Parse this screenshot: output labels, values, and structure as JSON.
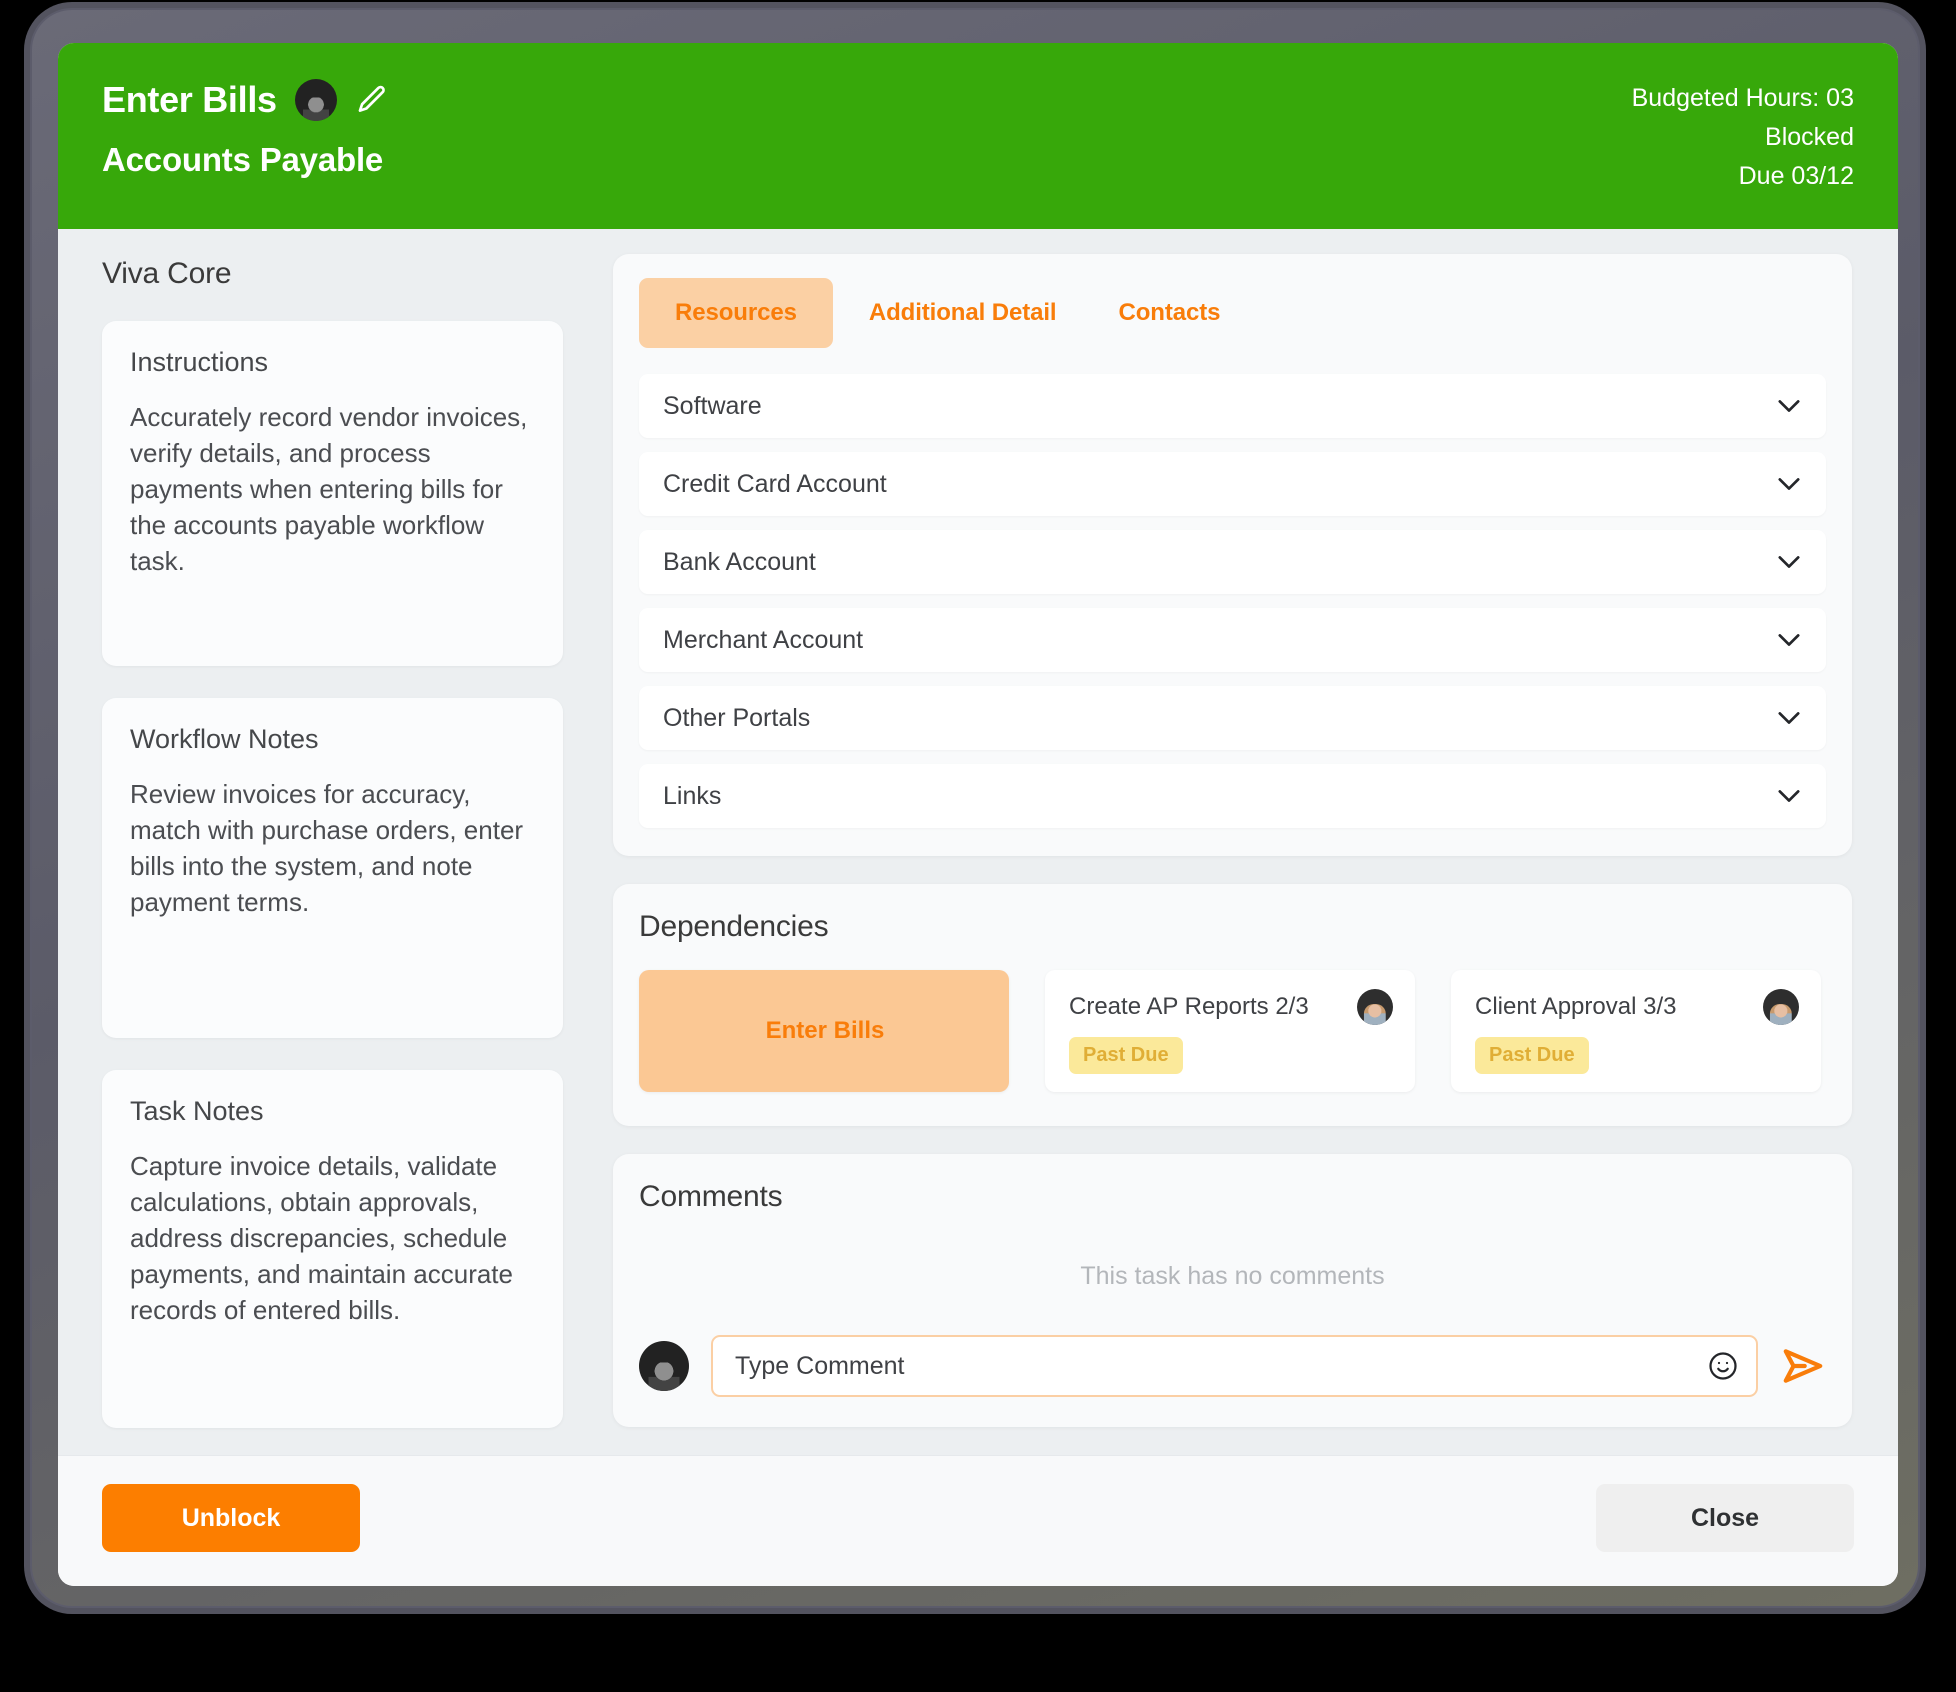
{
  "header": {
    "title": "Enter Bills",
    "subtitle": "Accounts Payable",
    "avatar_name": "assignee-avatar",
    "edit_icon": "pencil-icon",
    "budgeted_hours": "Budgeted Hours: 03",
    "status": "Blocked",
    "due": "Due 03/12",
    "background_color": "#37a80a"
  },
  "sidebar": {
    "title": "Viva Core",
    "cards": [
      {
        "title": "Instructions",
        "body": "Accurately record vendor invoices, verify details, and process payments when entering bills for the accounts payable workflow task."
      },
      {
        "title": "Workflow Notes",
        "body": "Review invoices for accuracy, match with purchase orders, enter bills into the system, and note payment terms."
      },
      {
        "title": "Task Notes",
        "body": "Capture invoice details, validate calculations, obtain approvals, address discrepancies, schedule payments, and maintain accurate records of entered bills."
      }
    ]
  },
  "resources": {
    "tabs": [
      {
        "label": "Resources",
        "active": true
      },
      {
        "label": "Additional Detail",
        "active": false
      },
      {
        "label": "Contacts",
        "active": false
      }
    ],
    "accent_color": "#f97d0a",
    "active_tab_bg": "#fbd0a4",
    "rows": [
      {
        "label": "Software",
        "icon": "chevron-down-icon"
      },
      {
        "label": "Credit Card Account",
        "icon": "chevron-down-icon"
      },
      {
        "label": "Bank Account",
        "icon": "chevron-down-icon"
      },
      {
        "label": "Merchant Account",
        "icon": "chevron-down-icon"
      },
      {
        "label": "Other Portals",
        "icon": "chevron-down-icon"
      },
      {
        "label": "Links",
        "icon": "chevron-down-icon"
      }
    ]
  },
  "dependencies": {
    "title": "Dependencies",
    "current": {
      "label": "Enter Bills"
    },
    "items": [
      {
        "name": "Create AP Reports 2/3",
        "badge": "Past Due",
        "avatar": "user-avatar"
      },
      {
        "name": "Client Approval 3/3",
        "badge": "Past Due",
        "avatar": "user-avatar"
      }
    ],
    "badge_bg": "#fbe99a",
    "badge_color": "#e0ae36"
  },
  "comments": {
    "title": "Comments",
    "empty_text": "This task has no comments",
    "input_value": "",
    "input_placeholder": "Type Comment",
    "emoji_icon": "smiley-icon",
    "send_icon": "send-icon",
    "avatar": "current-user-avatar"
  },
  "footer": {
    "primary_label": "Unblock",
    "secondary_label": "Close",
    "primary_color": "#fc7e00",
    "secondary_color": "#efefef"
  }
}
